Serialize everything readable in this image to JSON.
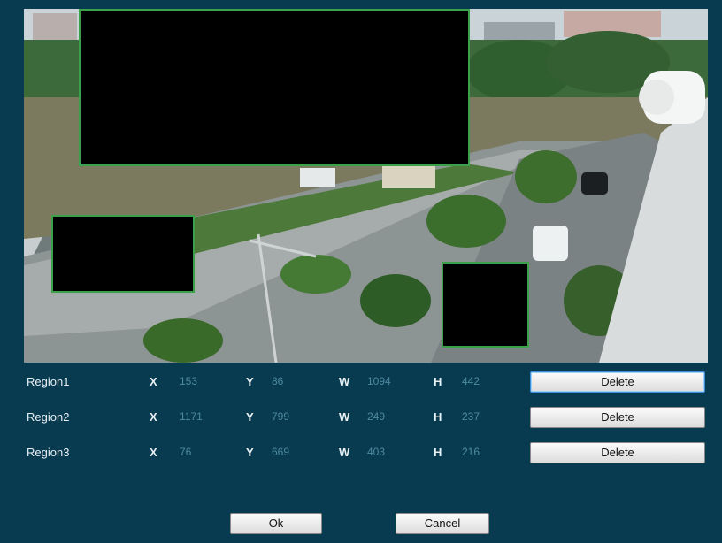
{
  "regions": [
    {
      "name": "Region1",
      "x_label": "X",
      "x": "153",
      "y_label": "Y",
      "y": "86",
      "w_label": "W",
      "w": "1094",
      "h_label": "H",
      "h": "442",
      "delete_label": "Delete"
    },
    {
      "name": "Region2",
      "x_label": "X",
      "x": "1171",
      "y_label": "Y",
      "y": "799",
      "w_label": "W",
      "w": "249",
      "h_label": "H",
      "h": "237",
      "delete_label": "Delete"
    },
    {
      "name": "Region3",
      "x_label": "X",
      "x": "76",
      "y_label": "Y",
      "y": "669",
      "w_label": "W",
      "w": "403",
      "h_label": "H",
      "h": "216",
      "delete_label": "Delete"
    }
  ],
  "footer": {
    "ok_label": "Ok",
    "cancel_label": "Cancel"
  },
  "colors": {
    "background": "#083a50",
    "mask_border": "#3aa04a",
    "value_text": "#4d8aa0"
  }
}
